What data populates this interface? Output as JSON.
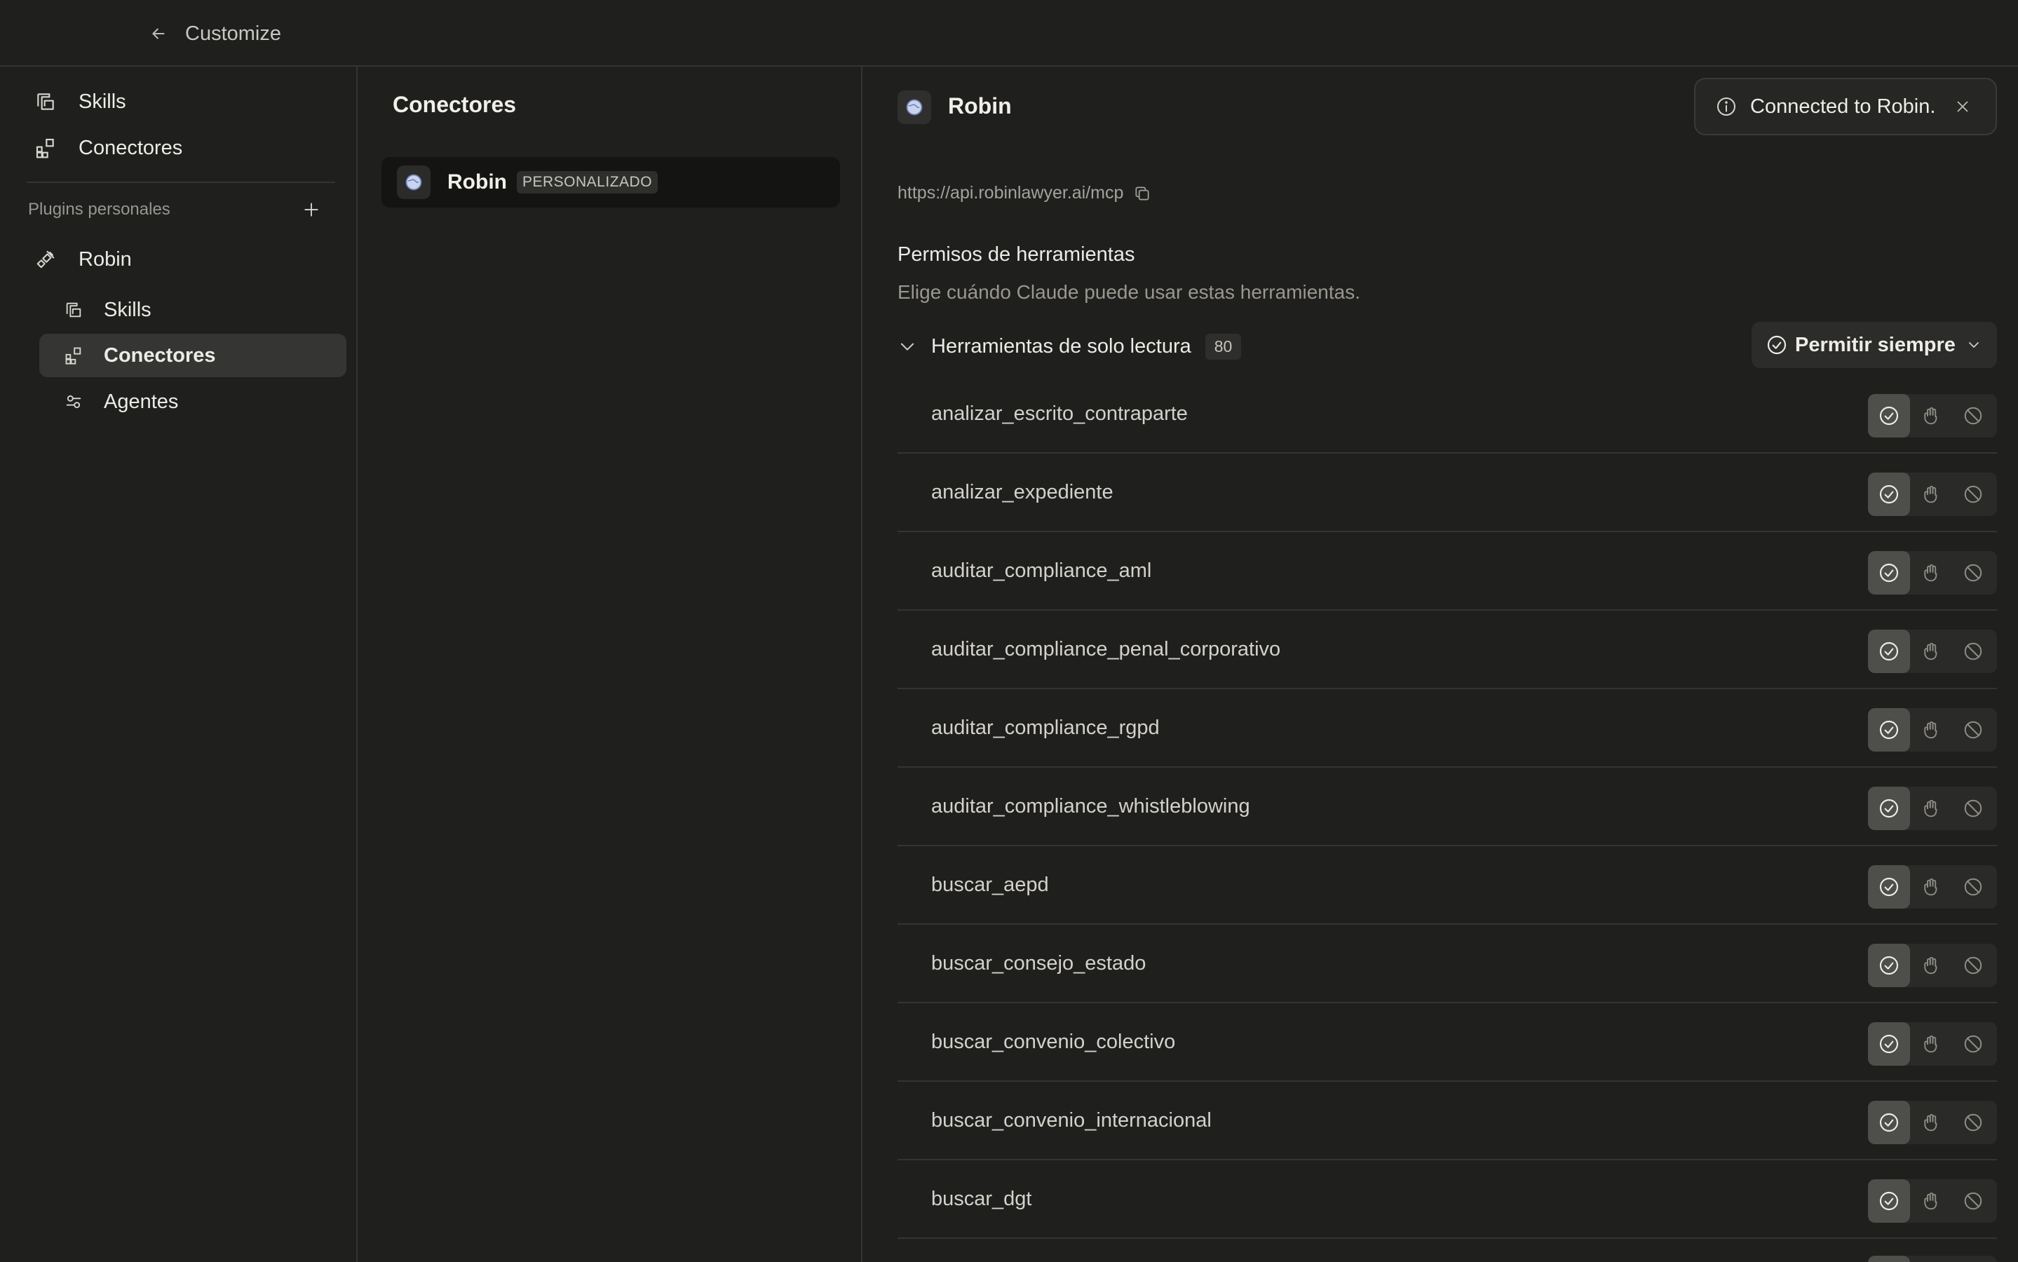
{
  "topbar": {
    "title": "Customize",
    "back_icon": "arrow-left-icon"
  },
  "sidebar": {
    "items": [
      {
        "label": "Skills",
        "icon": "skills-icon"
      },
      {
        "label": "Conectores",
        "icon": "connectors-icon"
      }
    ],
    "section_title": "Plugins personales",
    "plugin": {
      "label": "Robin",
      "icon": "plug-icon",
      "children": [
        {
          "label": "Skills",
          "icon": "skills-icon"
        },
        {
          "label": "Conectores",
          "icon": "connectors-icon",
          "active": true
        },
        {
          "label": "Agentes",
          "icon": "agents-icon"
        }
      ]
    }
  },
  "middle": {
    "title": "Conectores",
    "connector": {
      "name": "Robin",
      "badge": "PERSONALIZADO"
    }
  },
  "detail": {
    "title": "Robin",
    "toast": "Connected to Robin.",
    "url": "https://api.robinlawyer.ai/mcp",
    "permissions_title": "Permisos de herramientas",
    "permissions_subtitle": "Elige cuándo Claude puede usar estas herramientas.",
    "group": {
      "label": "Herramientas de solo lectura",
      "count": "80",
      "dropdown": "Permitir siempre"
    },
    "tools": [
      "analizar_escrito_contraparte",
      "analizar_expediente",
      "auditar_compliance_aml",
      "auditar_compliance_penal_corporativo",
      "auditar_compliance_rgpd",
      "auditar_compliance_whistleblowing",
      "buscar_aepd",
      "buscar_consejo_estado",
      "buscar_convenio_colectivo",
      "buscar_convenio_internacional",
      "buscar_dgt"
    ]
  },
  "colors": {
    "background": "#1f1f1e",
    "active_item": "#353533",
    "selected_option": "#4e4e4b"
  }
}
